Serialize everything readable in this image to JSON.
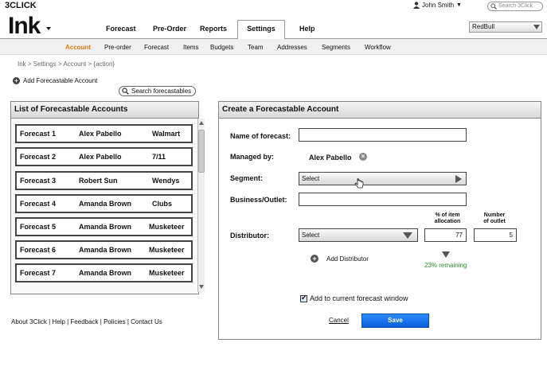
{
  "topbar": {
    "brand": "3CLICK",
    "user_name": "John Smith",
    "search_placeholder": "Search 3Click"
  },
  "header": {
    "logo": "Ink",
    "nav": [
      "Forecast",
      "Pre-Order",
      "Reports",
      "Settings",
      "Help"
    ],
    "active_nav": "Settings",
    "account_select": "RedBull"
  },
  "subnav": {
    "items": [
      "Account",
      "Pre-order",
      "Forecast",
      "Items",
      "Budgets",
      "Team",
      "Addresses",
      "Segments",
      "Workflow"
    ],
    "active": "Account"
  },
  "breadcrumb": "Ink > Settings > Account > {action}",
  "add_forecastable_label": "Add Forecastable Account",
  "search_forecastables_label": "Search forecastables",
  "list_panel": {
    "title": "List of Forecastable Accounts",
    "rows": [
      {
        "name": "Forecast 1",
        "manager": "Alex Pabello",
        "segment": "Walmart"
      },
      {
        "name": "Forecast 2",
        "manager": "Alex Pabello",
        "segment": "7/11"
      },
      {
        "name": "Forecast 3",
        "manager": "Robert Sun",
        "segment": "Wendys"
      },
      {
        "name": "Forecast 4",
        "manager": "Amanda Brown",
        "segment": "Clubs"
      },
      {
        "name": "Forecast 5",
        "manager": "Amanda Brown",
        "segment": "Musketeer"
      },
      {
        "name": "Forecast 6",
        "manager": "Amanda Brown",
        "segment": "Musketeer"
      },
      {
        "name": "Forecast 7",
        "manager": "Amanda Brown",
        "segment": "Musketeer"
      }
    ]
  },
  "footer": {
    "links": "About 3Click | Help | Feedback | Policies | Contact Us"
  },
  "form": {
    "title": "Create a Forecastable Account",
    "name_label": "Name of forecast:",
    "name_value": "",
    "managed_label": "Managed by:",
    "managed_value": "Alex Pabello",
    "segment_label": "Segment:",
    "segment_value": "Select",
    "business_label": "Business/Outlet:",
    "business_value": "",
    "distributor_label": "Distributor:",
    "distributor_value": "Select",
    "allocation_header_1": "% of item",
    "allocation_header_2": "allocation",
    "allocation_value": "77",
    "outlet_header_1": "Number",
    "outlet_header_2": "of outlet",
    "outlet_value": "5",
    "remaining": "23% remaining",
    "add_distributor_label": "Add Distributor",
    "add_window_label": "Add to current forecast window",
    "cancel_label": "Cancel",
    "save_label": "Save"
  }
}
